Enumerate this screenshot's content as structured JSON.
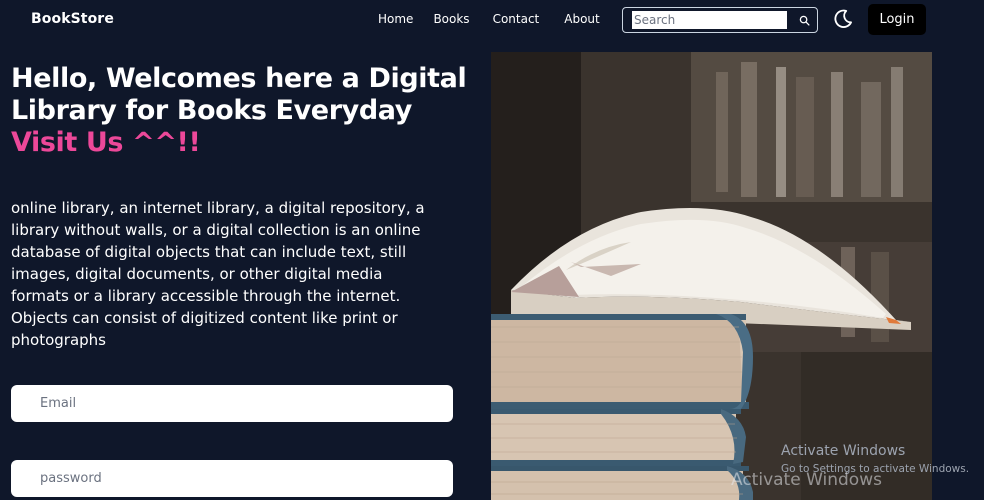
{
  "navbar": {
    "brand": "BookStore",
    "links": [
      "Home",
      "Books",
      "Contact",
      "About"
    ],
    "search_placeholder": "Search",
    "login_label": "Login"
  },
  "hero": {
    "title_line1": "Hello, Welcomes here a Digital",
    "title_line2": "Library for Books Everyday",
    "title_accent": "Visit Us ^^!!",
    "description": "online library, an internet library, a digital repository, a library without walls, or a digital collection is an online database of digital objects that can include text, still images, digital documents, or other digital media formats or a library accessible through the internet. Objects can consist of digitized content like print or photographs"
  },
  "form": {
    "email_placeholder": "Email",
    "password_placeholder": "password"
  },
  "overlay": {
    "activate_title": "Activate Windows",
    "activate_sub": "Go to Settings to activate Windows.",
    "activate_ghost": "Activate Windows"
  },
  "colors": {
    "background": "#0f172a",
    "accent": "#ec4899",
    "login_button": "#000000"
  },
  "icons": {
    "search": "search-icon",
    "theme": "moon-icon"
  }
}
